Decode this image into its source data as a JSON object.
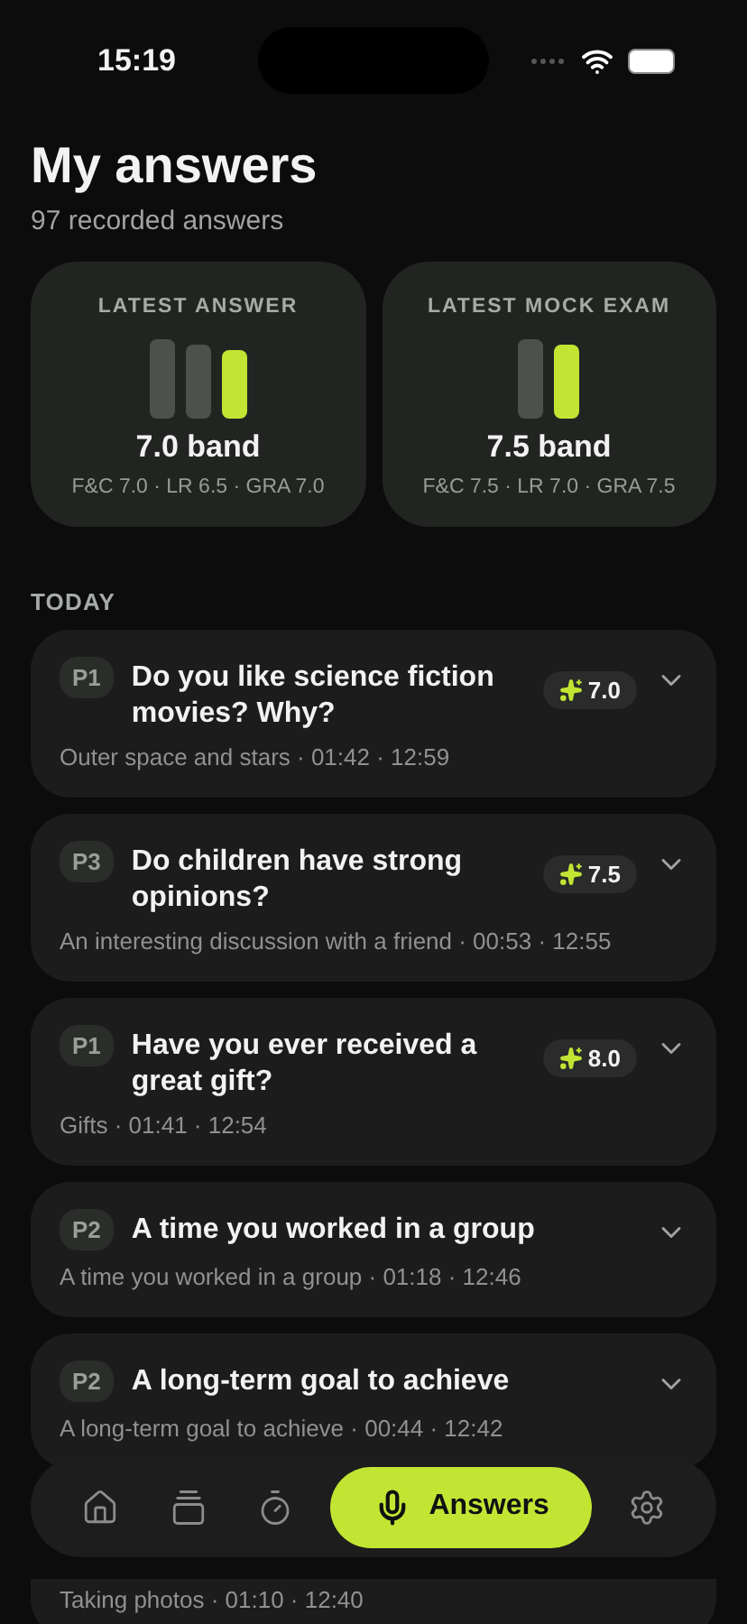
{
  "status_bar": {
    "time": "15:19"
  },
  "header": {
    "title": "My answers",
    "subtitle": "97 recorded answers"
  },
  "summary_cards": [
    {
      "label": "LATEST ANSWER",
      "band": "7.0 band",
      "breakdown": "F&C 7.0 · LR 6.5 · GRA 7.0",
      "bars": [
        {
          "selected": false
        },
        {
          "selected": false
        },
        {
          "selected": true
        }
      ]
    },
    {
      "label": "LATEST MOCK EXAM",
      "band": "7.5 band",
      "breakdown": "F&C 7.5 · LR 7.0 · GRA 7.5",
      "bars": [
        {
          "selected": false
        },
        {
          "selected": true
        }
      ]
    }
  ],
  "section": {
    "heading": "TODAY"
  },
  "answers": [
    {
      "part": "P1",
      "question": "Do you like science fiction movies? Why?",
      "meta": "Outer space and stars · 01:42 · 12:59",
      "score": "7.0"
    },
    {
      "part": "P3",
      "question": "Do children have strong opinions?",
      "meta": "An interesting discussion with a friend · 00:53 · 12:55",
      "score": "7.5"
    },
    {
      "part": "P1",
      "question": "Have you ever received a great gift?",
      "meta": "Gifts · 01:41 · 12:54",
      "score": "8.0"
    },
    {
      "part": "P2",
      "question": "A time you worked in a group",
      "meta": "A time you worked in a group · 01:18 · 12:46"
    },
    {
      "part": "P2",
      "question": "A long-term goal to achieve",
      "meta": "A long-term goal to achieve · 00:44 · 12:42"
    }
  ],
  "hidden_answer": {
    "meta": "Taking photos · 01:10 · 12:40"
  },
  "nav": [
    {
      "kind": "home",
      "selected": false
    },
    {
      "kind": "cards",
      "selected": false
    },
    {
      "kind": "timer",
      "selected": false
    },
    {
      "kind": "mic",
      "label": "Answers",
      "selected": true
    },
    {
      "kind": "settings",
      "selected": false
    }
  ]
}
